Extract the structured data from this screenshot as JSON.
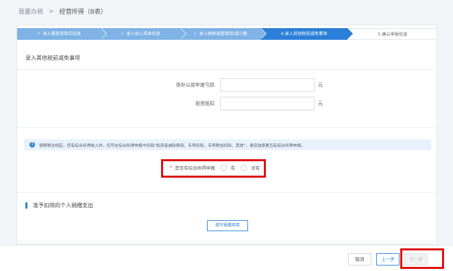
{
  "breadcrumb": {
    "home": "我要办税",
    "separator": ">",
    "current": "经营所得（B表）"
  },
  "steps": [
    {
      "label": "录入被投资单位信息",
      "done": true
    },
    {
      "label": "录入收入成本信息",
      "done": true
    },
    {
      "label": "录入纳税调整增加/减少额",
      "done": true
    },
    {
      "label": "4.录入其他税前减免事项",
      "done": false
    },
    {
      "label": "5.确认申报信息",
      "done": false
    }
  ],
  "step_check": "✓",
  "section_title": "录入其他税前减免事项",
  "form": {
    "loss_label": "弥补以前年度亏损",
    "loss_value": "",
    "loss_unit": "元",
    "invest_label": "投资抵扣",
    "invest_value": "",
    "invest_unit": "元"
  },
  "notice": {
    "icon": "info-icon",
    "icon_glyph": "i",
    "text": "按照税法规定，您有综合所得收入时，仅可在综合所得申报中扣除\"投资者减除费用、专项扣除、专项附加扣除、其他\"，请您选择是否有综合所得申报。"
  },
  "radio_question": {
    "required_mark": "*",
    "label": "是否有综合所得申报",
    "option_yes": "有",
    "option_no": "没有"
  },
  "donation": {
    "title": "准予扣除的个人捐赠支出",
    "fill_button": "填写捐赠项目"
  },
  "footer": {
    "cancel": "取消",
    "prev": "上一步",
    "next": "下一步"
  },
  "colors": {
    "accent": "#2b7fd8",
    "highlight": "#e01010"
  }
}
